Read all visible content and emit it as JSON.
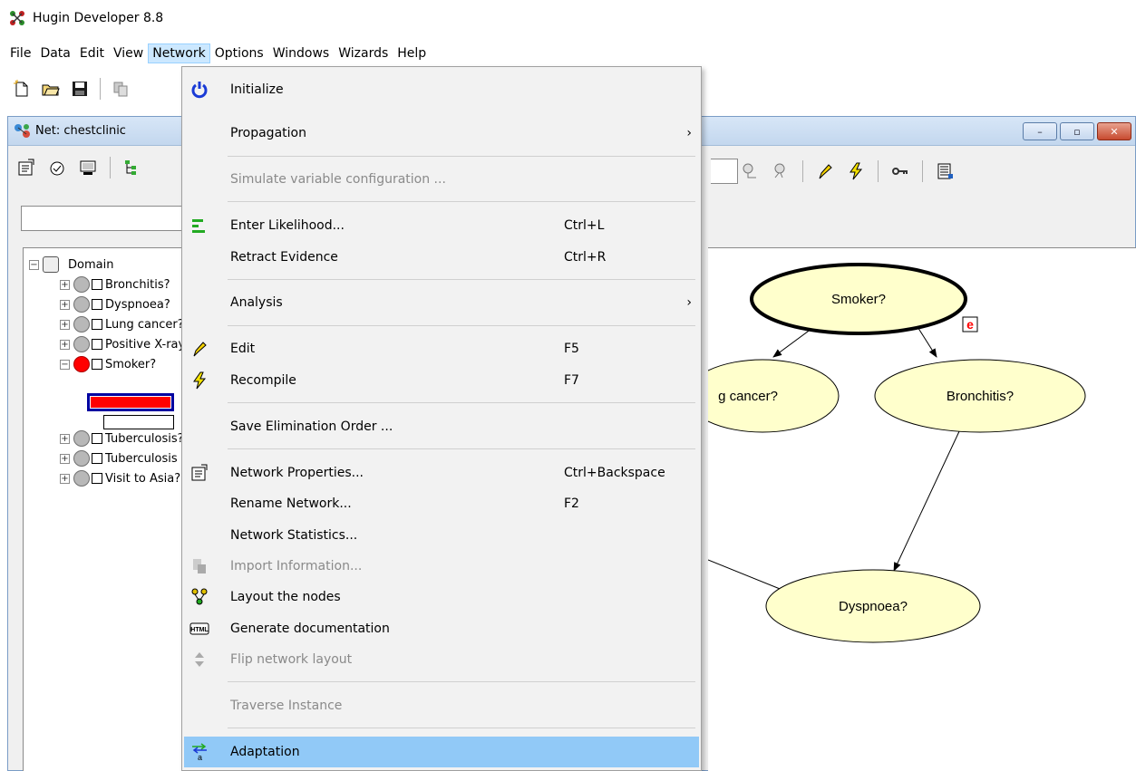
{
  "app": {
    "title": "Hugin Developer 8.8"
  },
  "menubar": {
    "items": [
      "File",
      "Data",
      "Edit",
      "View",
      "Network",
      "Options",
      "Windows",
      "Wizards",
      "Help"
    ],
    "active": "Network"
  },
  "child_window": {
    "title": "Net: chestclinic",
    "buttons": {
      "minimize": "–",
      "maximize": "▫",
      "close": "✕"
    }
  },
  "tree": {
    "root": "Domain",
    "nodes": [
      {
        "label": "Bronchitis?",
        "expand": "+",
        "state": "gray"
      },
      {
        "label": "Dyspnoea?",
        "expand": "+",
        "state": "gray"
      },
      {
        "label": "Lung cancer?",
        "expand": "+",
        "state": "gray"
      },
      {
        "label": "Positive X-ray?",
        "expand": "+",
        "state": "gray"
      },
      {
        "label": "Smoker?",
        "expand": "−",
        "state": "red"
      },
      {
        "label": "Tuberculosis?",
        "expand": "+",
        "state": "gray"
      },
      {
        "label": "Tuberculosis or cancer?",
        "expand": "+",
        "state": "gray"
      },
      {
        "label": "Visit to Asia?",
        "expand": "+",
        "state": "gray"
      }
    ]
  },
  "graph": {
    "nodes": {
      "smoker": "Smoker?",
      "lung_cancer": "g cancer?",
      "bronchitis": "Bronchitis?",
      "dyspnoea": "Dyspnoea?"
    },
    "evidence_marker": "e"
  },
  "network_menu": {
    "items": [
      {
        "icon": "initialize-icon",
        "label": "Initialize",
        "shortcut": "",
        "submenu": false,
        "disabled": false
      },
      {
        "icon": "",
        "label": "Propagation",
        "shortcut": "",
        "submenu": true,
        "disabled": false
      },
      {
        "icon": "",
        "label": "Simulate variable configuration ...",
        "shortcut": "",
        "submenu": false,
        "disabled": true
      },
      {
        "icon": "likelihood-icon",
        "label": "Enter Likelihood...",
        "shortcut": "Ctrl+L",
        "submenu": false,
        "disabled": false
      },
      {
        "icon": "",
        "label": "Retract Evidence",
        "shortcut": "Ctrl+R",
        "submenu": false,
        "disabled": false
      },
      {
        "icon": "",
        "label": "Analysis",
        "shortcut": "",
        "submenu": true,
        "disabled": false
      },
      {
        "icon": "pencil-icon",
        "label": "Edit",
        "shortcut": "F5",
        "submenu": false,
        "disabled": false
      },
      {
        "icon": "lightning-icon",
        "label": "Recompile",
        "shortcut": "F7",
        "submenu": false,
        "disabled": false
      },
      {
        "icon": "",
        "label": "Save Elimination Order ...",
        "shortcut": "",
        "submenu": false,
        "disabled": false
      },
      {
        "icon": "properties-icon",
        "label": "Network Properties...",
        "shortcut": "Ctrl+Backspace",
        "submenu": false,
        "disabled": false
      },
      {
        "icon": "",
        "label": "Rename Network...",
        "shortcut": "F2",
        "submenu": false,
        "disabled": false
      },
      {
        "icon": "",
        "label": "Network Statistics...",
        "shortcut": "",
        "submenu": false,
        "disabled": false
      },
      {
        "icon": "import-icon",
        "label": "Import Information...",
        "shortcut": "",
        "submenu": false,
        "disabled": true
      },
      {
        "icon": "layout-icon",
        "label": "Layout the nodes",
        "shortcut": "",
        "submenu": false,
        "disabled": false
      },
      {
        "icon": "html-icon",
        "label": "Generate documentation",
        "shortcut": "",
        "submenu": false,
        "disabled": false
      },
      {
        "icon": "flip-icon",
        "label": "Flip network layout",
        "shortcut": "",
        "submenu": false,
        "disabled": true
      },
      {
        "icon": "",
        "label": "Traverse Instance",
        "shortcut": "",
        "submenu": false,
        "disabled": true
      },
      {
        "icon": "adaptation-icon",
        "label": "Adaptation",
        "shortcut": "",
        "submenu": false,
        "disabled": false,
        "highlighted": true
      }
    ],
    "icon_glyphs": {
      "html": "HTML",
      "adaptation": "a"
    }
  },
  "colors": {
    "menu_highlight": "#91c9f7",
    "node_fill": "#ffffcc",
    "evidence_red": "#ff0000",
    "selected_node_bar_border": "#0000a0"
  }
}
